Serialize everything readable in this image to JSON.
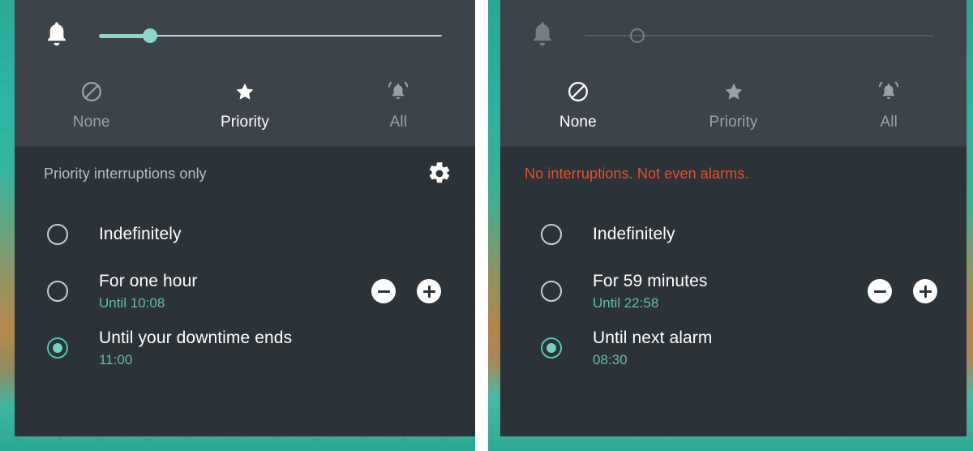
{
  "meta": {
    "accent_teal": "#6fd4c3",
    "slider_teal": "#8ed6cb",
    "warn_orange": "#e8512a",
    "panel_top_bg": "#3c434a",
    "panel_bottom_bg": "#2b3238",
    "subtext_teal": "#65bdb0"
  },
  "left_panel": {
    "volume": {
      "bell_icon": "bell-icon",
      "slider_value_percent": 15,
      "slider_enabled": true
    },
    "modes": [
      {
        "id": "none",
        "label": "None",
        "icon": "do-not-disturb-icon",
        "active": false
      },
      {
        "id": "priority",
        "label": "Priority",
        "icon": "star-icon",
        "active": true
      },
      {
        "id": "all",
        "label": "All",
        "icon": "bell-ringing-icon",
        "active": false
      }
    ],
    "condition": {
      "text": "Priority interruptions only",
      "is_warning": false,
      "settings_icon": "gear-icon"
    },
    "options": [
      {
        "id": "indefinitely",
        "title": "Indefinitely",
        "subtitle": "",
        "selected": false,
        "has_steppers": false
      },
      {
        "id": "duration",
        "title": "For one hour",
        "subtitle": "Until 10:08",
        "selected": false,
        "has_steppers": true,
        "minus_label": "−",
        "plus_label": "+"
      },
      {
        "id": "downtime",
        "title": "Until your downtime ends",
        "subtitle": "11:00",
        "selected": true,
        "has_steppers": false
      }
    ]
  },
  "right_panel": {
    "volume": {
      "bell_icon": "bell-icon",
      "slider_value_percent": 15,
      "slider_enabled": false
    },
    "modes": [
      {
        "id": "none",
        "label": "None",
        "icon": "do-not-disturb-icon",
        "active": true
      },
      {
        "id": "priority",
        "label": "Priority",
        "icon": "star-icon",
        "active": false
      },
      {
        "id": "all",
        "label": "All",
        "icon": "bell-ringing-icon",
        "active": false
      }
    ],
    "condition": {
      "text": "No interruptions. Not even alarms.",
      "is_warning": true,
      "settings_icon": ""
    },
    "options": [
      {
        "id": "indefinitely",
        "title": "Indefinitely",
        "subtitle": "",
        "selected": false,
        "has_steppers": false
      },
      {
        "id": "duration",
        "title": "For 59 minutes",
        "subtitle": "Until 22:58",
        "selected": false,
        "has_steppers": true,
        "minus_label": "−",
        "plus_label": "+"
      },
      {
        "id": "nextalarm",
        "title": "Until next alarm",
        "subtitle": "08:30",
        "selected": true,
        "has_steppers": false
      }
    ]
  }
}
